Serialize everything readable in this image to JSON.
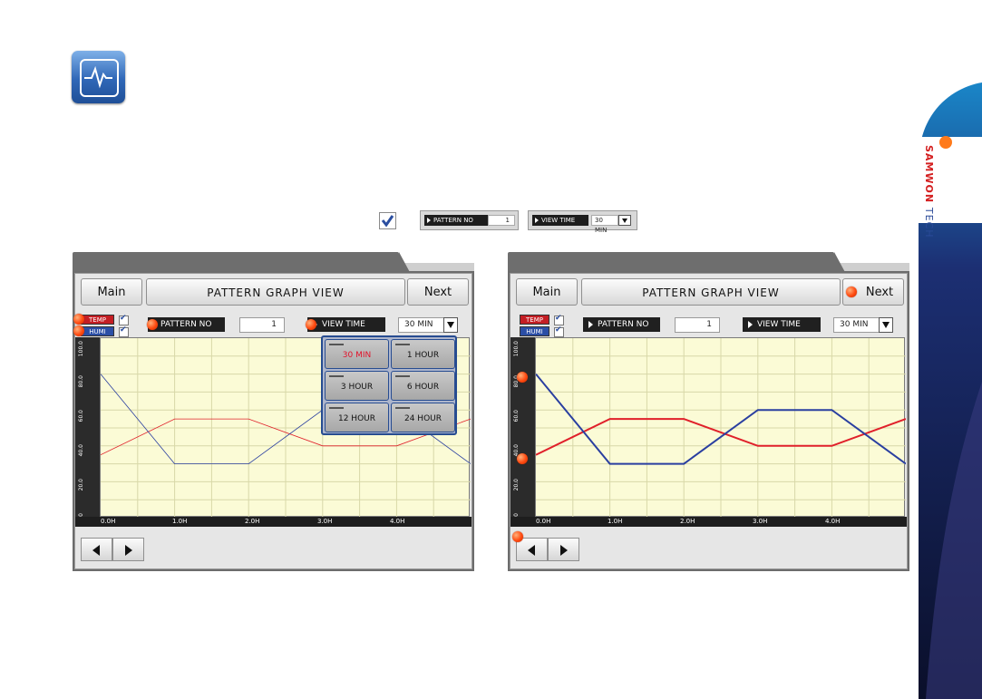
{
  "legend_row": {
    "pattern_no_label": "PATTERN NO",
    "pattern_no_value": "1",
    "view_time_label": "VIEW TIME",
    "view_time_value": "30 MIN"
  },
  "brand": {
    "text_a": "SAMWON",
    "text_b": "TECH"
  },
  "panel_left": {
    "main_label": "Main",
    "title": "PATTERN GRAPH VIEW",
    "next_label": "Next",
    "temp_label": "TEMP",
    "humi_label": "HUMI",
    "pattern_no_label": "PATTERN NO",
    "pattern_no_value": "1",
    "view_time_label": "VIEW TIME",
    "view_time_value": "30 MIN",
    "popup_options": [
      "30 MIN",
      "1 HOUR",
      "3 HOUR",
      "6 HOUR",
      "12 HOUR",
      "24 HOUR"
    ],
    "popup_selected": "30 MIN"
  },
  "panel_right": {
    "main_label": "Main",
    "title": "PATTERN GRAPH VIEW",
    "next_label": "Next",
    "temp_label": "TEMP",
    "humi_label": "HUMI",
    "pattern_no_label": "PATTERN NO",
    "pattern_no_value": "1",
    "view_time_label": "VIEW TIME",
    "view_time_value": "30 MIN"
  },
  "axis": {
    "x_ticks": [
      "0.0H",
      "1.0H",
      "2.0H",
      "3.0H",
      "4.0H"
    ],
    "y_ticks": [
      "100.0",
      "80.0",
      "60.0",
      "40.0",
      "20.0",
      "0.0"
    ]
  },
  "colors": {
    "temp": "#e0202a",
    "humi": "#2a3fa0",
    "plot_bg": "#fbfbd6",
    "grid": "#d8d8a8"
  },
  "chart_data": {
    "type": "line",
    "x": [
      0,
      1,
      2,
      3,
      4,
      5
    ],
    "series": [
      {
        "name": "TEMP",
        "values": [
          35,
          55,
          55,
          40,
          40,
          55
        ]
      },
      {
        "name": "HUMI",
        "values": [
          80,
          30,
          30,
          60,
          60,
          30
        ]
      }
    ],
    "ylim": [
      0,
      100
    ]
  }
}
